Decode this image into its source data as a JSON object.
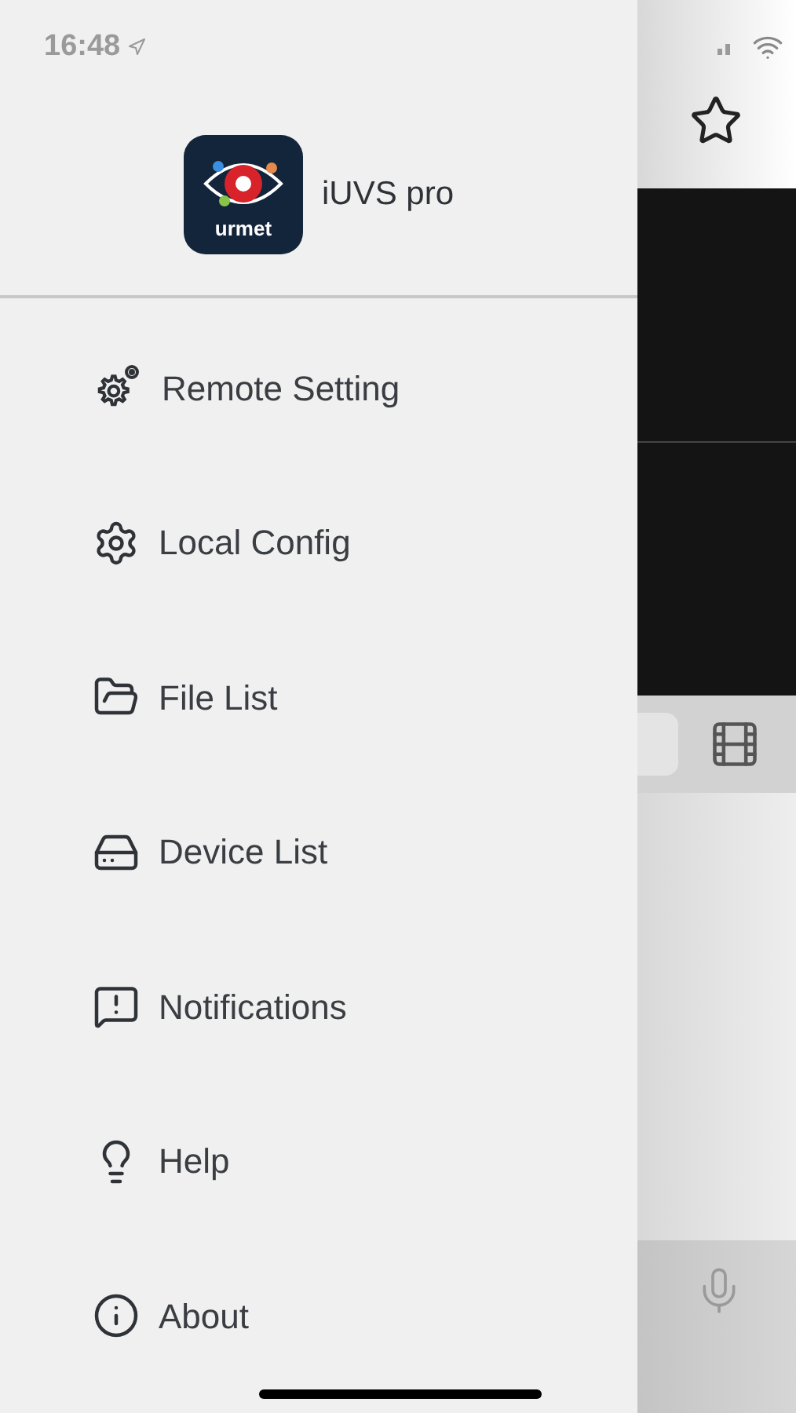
{
  "status_bar": {
    "time": "16:48"
  },
  "drawer": {
    "app": {
      "name": "iUVS pro",
      "logo_text": "urmet"
    },
    "items": [
      {
        "label": "Remote Setting",
        "kind": "remote"
      },
      {
        "label": "Local Config",
        "kind": "config"
      },
      {
        "label": "File List",
        "kind": "files"
      },
      {
        "label": "Device List",
        "kind": "devices"
      },
      {
        "label": "Notifications",
        "kind": "notifications"
      },
      {
        "label": "Help",
        "kind": "help"
      },
      {
        "label": "About",
        "kind": "about"
      }
    ]
  }
}
